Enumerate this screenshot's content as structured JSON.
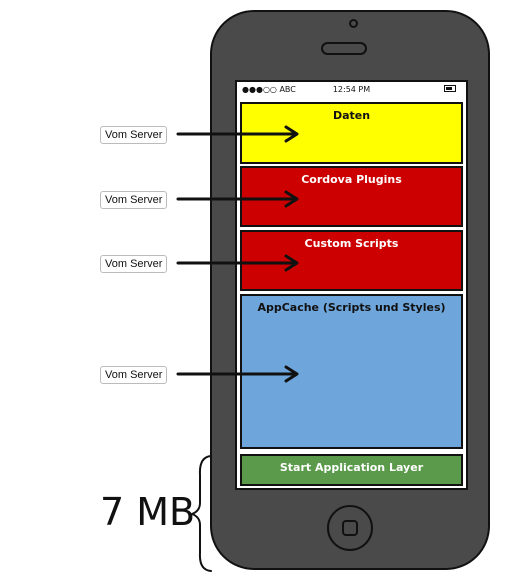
{
  "status_bar": {
    "signal": "●●●○○ ABC",
    "time": "12:54 PM",
    "battery_icon": "battery-icon"
  },
  "blocks": [
    {
      "label": "Daten",
      "color": "#ffff00"
    },
    {
      "label": "Cordova Plugins",
      "color": "#cc0000"
    },
    {
      "label": "Custom Scripts",
      "color": "#cc0000"
    },
    {
      "label": "AppCache (Scripts und Styles)",
      "color": "#6ea6dc"
    },
    {
      "label": "Start Application Layer",
      "color": "#5b9a4b"
    }
  ],
  "server_labels": [
    "Vom Server",
    "Vom Server",
    "Vom Server",
    "Vom Server"
  ],
  "size": {
    "label": "7 MB",
    "brace_icon": "curly-brace-icon"
  }
}
